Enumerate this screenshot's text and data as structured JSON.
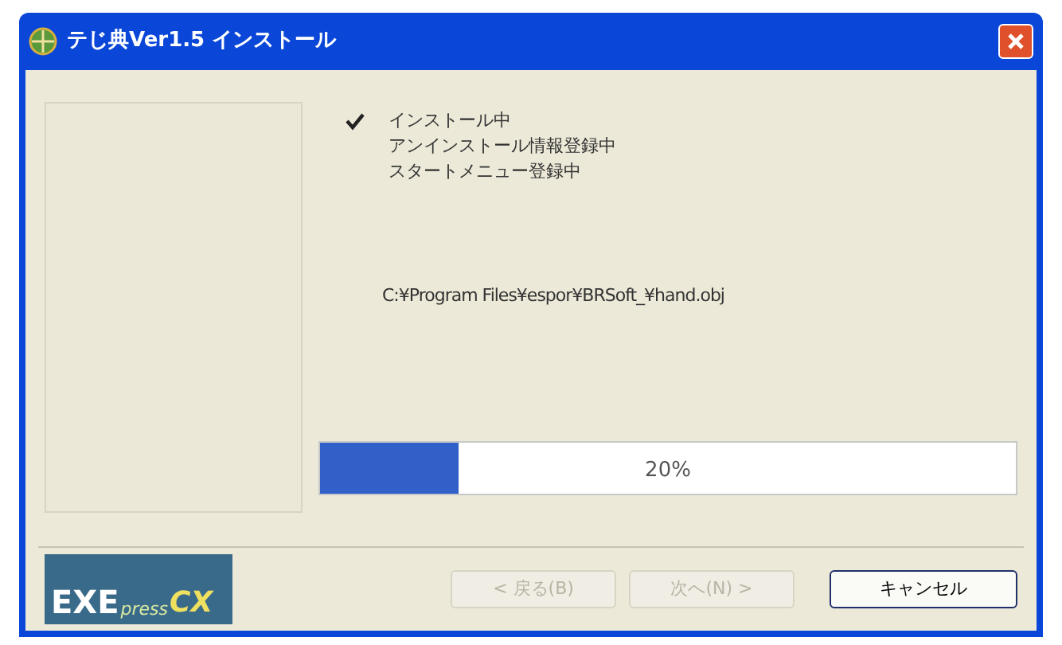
{
  "window": {
    "title": "テじ典Ver1.5 インストール"
  },
  "steps": [
    {
      "label": "インストール中",
      "checked": true
    },
    {
      "label": "アンインストール情報登録中",
      "checked": false
    },
    {
      "label": "スタートメニュー登録中",
      "checked": false
    }
  ],
  "current_file": "C:¥Program Files¥espor¥BRSoft_¥hand.obj",
  "progress": {
    "level": 0.2,
    "reading": "20%"
  },
  "logo": {
    "main": "EXE",
    "sub": "press",
    "suffix": "CX"
  },
  "buttons": [
    {
      "label": "< 戻る(B)",
      "disabled": true
    },
    {
      "label": "次へ(N) >",
      "disabled": true
    },
    {
      "label": "キャンセル",
      "disabled": false
    }
  ]
}
